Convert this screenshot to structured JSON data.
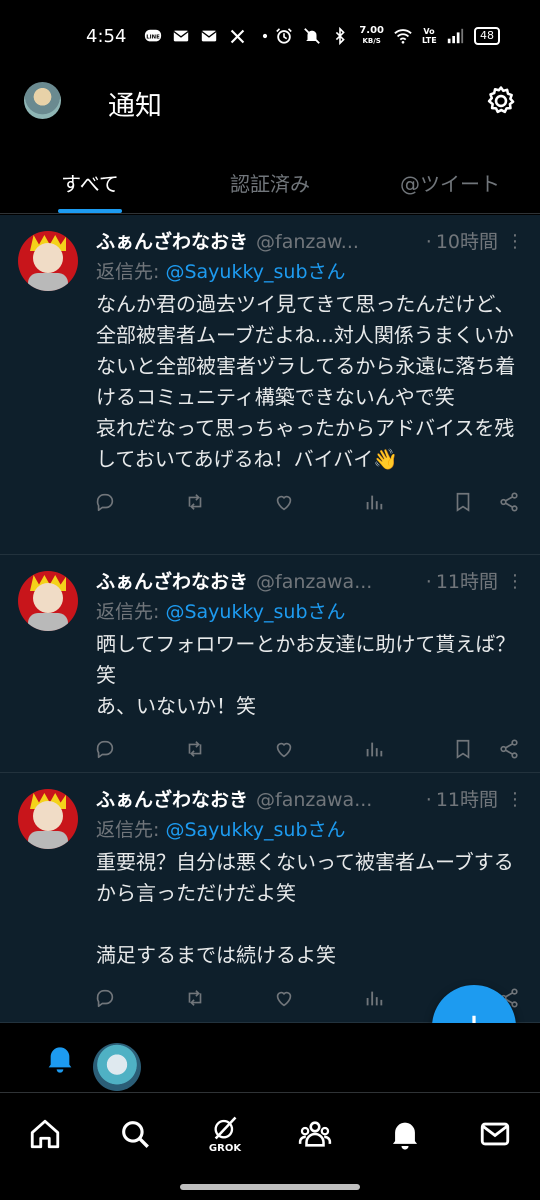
{
  "status_bar": {
    "time": "4:54",
    "net_speed_value": "7.00",
    "net_speed_unit": "KB/S",
    "volte": "Vo LTE",
    "battery": "48",
    "left_icons": [
      "line-icon",
      "mail-icon",
      "mail-icon",
      "x-icon",
      "dot-icon"
    ],
    "right_icons": [
      "alarm-icon",
      "mute-icon",
      "bluetooth-icon",
      "wifi-icon",
      "signal-icon"
    ]
  },
  "header": {
    "title": "通知"
  },
  "tabs": [
    {
      "label": "すべて",
      "active": true
    },
    {
      "label": "認証済み",
      "active": false
    },
    {
      "label": "@ツイート",
      "active": false
    }
  ],
  "tweets": [
    {
      "name": "ふぁんざわなおき",
      "handle": "@fanzaw...",
      "dot": "·",
      "ago": "10時間",
      "reply_prefix": "返信先: ",
      "reply_mention": "@Sayukky_subさん",
      "text": "なんか君の過去ツイ見てきて思ったんだけど、全部被害者ムーブだよね...対人関係うまくいかないと全部被害者ヅラしてるから永遠に落ち着けるコミュニティ構築できないんやで笑\n哀れだなって思っちゃったからアドバイスを残しておいてあげるね！バイバイ👋"
    },
    {
      "name": "ふぁんざわなおき",
      "handle": "@fanzawa...",
      "dot": "·",
      "ago": "11時間",
      "reply_prefix": "返信先: ",
      "reply_mention": "@Sayukky_subさん",
      "text": "晒してフォロワーとかお友達に助けて貰えば？笑\nあ、いないか！笑"
    },
    {
      "name": "ふぁんざわなおき",
      "handle": "@fanzawa...",
      "dot": "·",
      "ago": "11時間",
      "reply_prefix": "返信先: ",
      "reply_mention": "@Sayukky_subさん",
      "text": "重要視？自分は悪くないって被害者ムーブするから言っただけだよ笑\n\n満足するまでは続けるよ笑"
    }
  ],
  "bottom_nav": {
    "grok_label": "GROK",
    "items": [
      "home-icon",
      "search-icon",
      "grok-icon",
      "communities-icon",
      "notifications-icon",
      "messages-icon"
    ]
  },
  "colors": {
    "accent": "#1d9bf0",
    "feed_bg": "#0e1f2b",
    "muted": "#71767b",
    "avatar_red": "#c8151b"
  }
}
